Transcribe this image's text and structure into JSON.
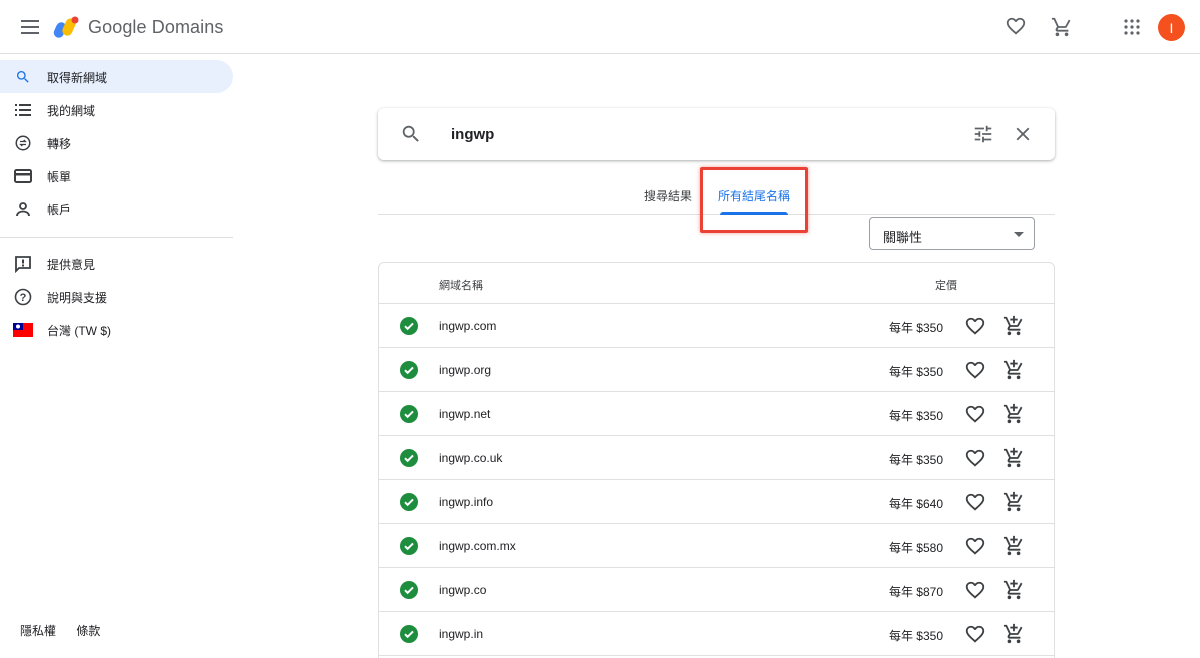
{
  "header": {
    "brand": "Google Domains",
    "avatar_initial": "I"
  },
  "sidebar": {
    "items": [
      {
        "label": "取得新網域",
        "icon": "search-icon"
      },
      {
        "label": "我的網域",
        "icon": "list-icon"
      },
      {
        "label": "轉移",
        "icon": "transfer-icon"
      },
      {
        "label": "帳單",
        "icon": "credit-card-icon"
      },
      {
        "label": "帳戶",
        "icon": "person-icon"
      },
      {
        "label": "提供意見",
        "icon": "feedback-icon"
      },
      {
        "label": "說明與支援",
        "icon": "help-icon"
      },
      {
        "label": "台灣 (TW $)",
        "icon": "taiwan-flag-icon"
      }
    ],
    "footer": {
      "privacy": "隱私權",
      "terms": "條款"
    }
  },
  "search": {
    "value": "ingwp"
  },
  "tabs": {
    "results": "搜尋結果",
    "all_endings": "所有結尾名稱"
  },
  "sort": {
    "selected": "關聯性"
  },
  "table": {
    "col_name": "網域名稱",
    "col_price": "定價",
    "rows": [
      {
        "domain": "ingwp.com",
        "price": "每年 $350"
      },
      {
        "domain": "ingwp.org",
        "price": "每年 $350"
      },
      {
        "domain": "ingwp.net",
        "price": "每年 $350"
      },
      {
        "domain": "ingwp.co.uk",
        "price": "每年 $350"
      },
      {
        "domain": "ingwp.info",
        "price": "每年 $640"
      },
      {
        "domain": "ingwp.com.mx",
        "price": "每年 $580"
      },
      {
        "domain": "ingwp.co",
        "price": "每年 $870"
      },
      {
        "domain": "ingwp.in",
        "price": "每年 $350"
      }
    ]
  },
  "colors": {
    "accent": "#1a73e8",
    "available": "#1e8e3e",
    "highlight": "#ea4335",
    "avatar": "#f4511e",
    "active_nav": "#e8f0fe"
  }
}
